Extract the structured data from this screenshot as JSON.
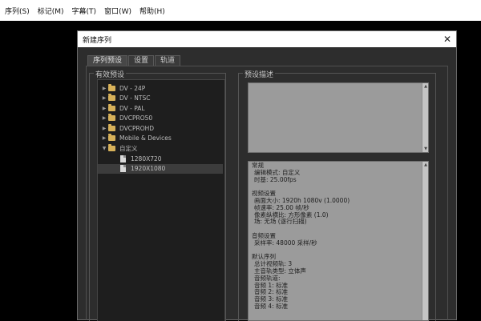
{
  "menubar": {
    "items": [
      "序列(S)",
      "标记(M)",
      "字幕(T)",
      "窗口(W)",
      "帮助(H)"
    ]
  },
  "dialog": {
    "title": "新建序列",
    "close_glyph": "✕",
    "tabs": [
      "序列预设",
      "设置",
      "轨道"
    ],
    "left_group_label": "有效预设",
    "right_group_label": "预设描述",
    "tree": [
      {
        "label": "DV - 24P",
        "type": "folder",
        "expanded": false
      },
      {
        "label": "DV - NTSC",
        "type": "folder",
        "expanded": false
      },
      {
        "label": "DV - PAL",
        "type": "folder",
        "expanded": false
      },
      {
        "label": "DVCPRO50",
        "type": "folder",
        "expanded": false
      },
      {
        "label": "DVCPROHD",
        "type": "folder",
        "expanded": false
      },
      {
        "label": "Mobile & Devices",
        "type": "folder",
        "expanded": false
      },
      {
        "label": "自定义",
        "type": "folder",
        "expanded": true
      },
      {
        "label": "1280X720",
        "type": "file",
        "selected": false
      },
      {
        "label": "1920X1080",
        "type": "file",
        "selected": true
      }
    ],
    "description_lines": [
      {
        "text": "常规",
        "indent": false
      },
      {
        "text": "编辑模式: 自定义",
        "indent": true
      },
      {
        "text": "时基: 25.00fps",
        "indent": true
      },
      {
        "text": "",
        "indent": false
      },
      {
        "text": "视频设置",
        "indent": false
      },
      {
        "text": "画面大小: 1920h 1080v (1.0000)",
        "indent": true
      },
      {
        "text": "帧速率: 25.00 帧/秒",
        "indent": true
      },
      {
        "text": "像素纵横比: 方形像素 (1.0)",
        "indent": true
      },
      {
        "text": "场: 无场 (逐行扫描)",
        "indent": true
      },
      {
        "text": "",
        "indent": false
      },
      {
        "text": "音频设置",
        "indent": false
      },
      {
        "text": "采样率: 48000 采样/秒",
        "indent": true
      },
      {
        "text": "",
        "indent": false
      },
      {
        "text": "默认序列",
        "indent": false
      },
      {
        "text": "总计视频轨: 3",
        "indent": true
      },
      {
        "text": "主音轨类型: 立体声",
        "indent": true
      },
      {
        "text": "音频轨道:",
        "indent": true
      },
      {
        "text": "音频 1: 标准",
        "indent": true
      },
      {
        "text": "音频 2: 标准",
        "indent": true
      },
      {
        "text": "音频 3: 标准",
        "indent": true
      },
      {
        "text": "音频 4: 标准",
        "indent": true
      }
    ]
  },
  "icons": {
    "folder": "folder-icon",
    "file": "file-icon",
    "expand_collapsed": "▶",
    "expand_expanded": "▼",
    "scroll_up": "▲",
    "scroll_down": "▼"
  },
  "colors": {
    "folder": "#d8b25a",
    "dialog_bg": "#2d2d2d",
    "panel_bg": "#1e1e1e",
    "desc_bg": "#9b9b9b"
  }
}
